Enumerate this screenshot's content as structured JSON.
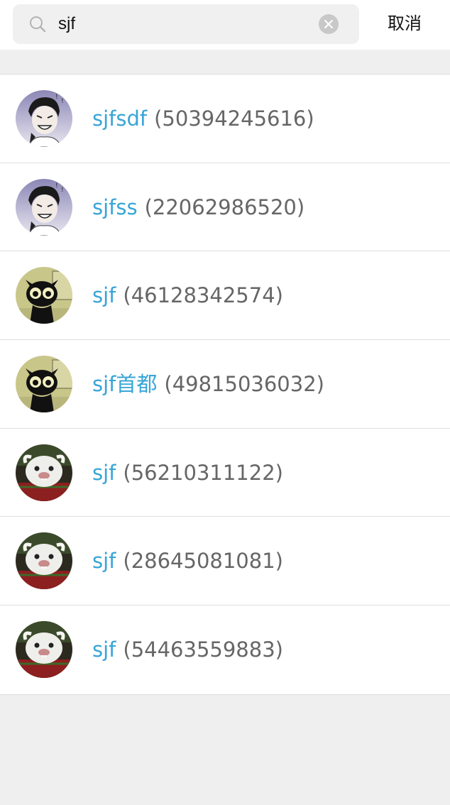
{
  "search": {
    "value": "sjf",
    "cancel_label": "取消",
    "icon": "search-icon",
    "clear_icon": "clear-icon"
  },
  "results": [
    {
      "name": "sjfsdf",
      "id": "(50394245616)",
      "avatar": "cartoon-man"
    },
    {
      "name": "sjfss",
      "id": "(22062986520)",
      "avatar": "cartoon-man"
    },
    {
      "name": "sjf",
      "id": "(46128342574)",
      "avatar": "black-cat"
    },
    {
      "name": "sjf首都",
      "id": "(49815036032)",
      "avatar": "black-cat"
    },
    {
      "name": "sjf",
      "id": "(56210311122)",
      "avatar": "poro"
    },
    {
      "name": "sjf",
      "id": "(28645081081)",
      "avatar": "poro"
    },
    {
      "name": "sjf",
      "id": "(54463559883)",
      "avatar": "poro"
    }
  ],
  "colors": {
    "name": "#38a5d6",
    "number": "#666666",
    "background": "#efefef"
  }
}
